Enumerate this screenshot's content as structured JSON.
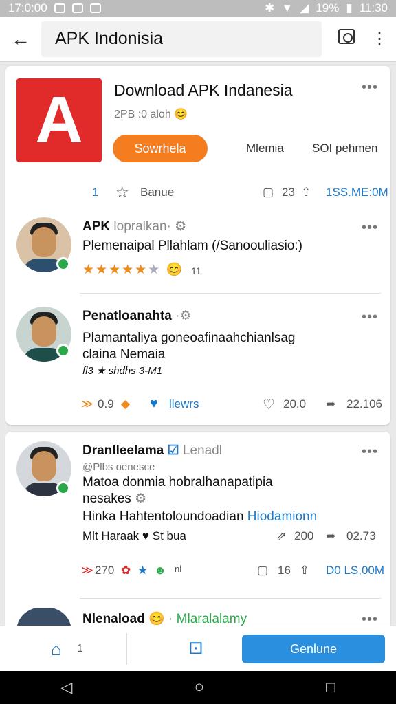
{
  "status_bar": {
    "time_left": "17:0:00",
    "battery": "19%",
    "time_right": "11:30"
  },
  "app_bar": {
    "title": "APK Indonisia"
  },
  "app_card": {
    "name": "Download APK Indanesia",
    "subtitle": "2PB :0 aloh",
    "download_label": "Sowrhela",
    "meta_left": "Mlemia",
    "meta_right": "SOI pehmen",
    "count_left": "1",
    "star_label": "Banue",
    "comment_count": "23",
    "size": "1SS.ME:0M"
  },
  "posts": [
    {
      "name": "APK",
      "name_suffix": "lopralkan·",
      "text": "Plemenaipal Pllahlam (/Sanoouliasio:)",
      "rating_value": "11"
    },
    {
      "name": "Penatloanahta",
      "text_line1": "Plamantaliya goneoafinaahchianlsag",
      "text_line2": "claina Nemaia",
      "tags": "fl3 ★ shdhs 3-M1",
      "stat_a": "0.9",
      "link_label": "llewrs",
      "likes": "20.0",
      "shares": "22.106"
    }
  ],
  "card2_post": {
    "name": "Dranlleelama",
    "name_suffix": "Lenadl",
    "handle": "@Plbs oenesce",
    "text_line1": "Matoa donmia hobralhanapatipia",
    "text_line2": "nesakes",
    "text_line3": "Hinka Hahtentoloundoadian",
    "text_line3_link": "Hiodamionn",
    "text_line4": "Mlt Haraak",
    "text_line4_b": "St bua",
    "stat_up": "200",
    "stat_share": "02.73",
    "reactions": "270",
    "reactions_suffix": "nl",
    "comments": "16",
    "size": "D0 LS,00M"
  },
  "next_post": {
    "name": "Nlenaload",
    "name_suffix": "Mlaralalamy"
  },
  "bottom_bar": {
    "home_count": "1",
    "generate_label": "Genlune"
  }
}
